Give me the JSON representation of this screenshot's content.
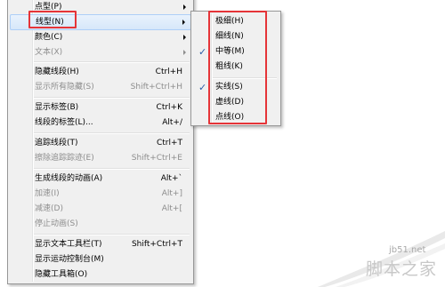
{
  "menu": {
    "items": [
      {
        "label": "点型(P)",
        "shortcut": "",
        "submenu": true,
        "disabled": false
      },
      {
        "label": "线型(N)",
        "shortcut": "",
        "submenu": true,
        "disabled": false
      },
      {
        "label": "颜色(C)",
        "shortcut": "",
        "submenu": true,
        "disabled": false
      },
      {
        "label": "文本(X)",
        "shortcut": "",
        "submenu": true,
        "disabled": true
      },
      {
        "label": "隐藏线段(H)",
        "shortcut": "Ctrl+H",
        "submenu": false,
        "disabled": false
      },
      {
        "label": "显示所有隐藏(S)",
        "shortcut": "Shift+Ctrl+H",
        "submenu": false,
        "disabled": true
      },
      {
        "label": "显示标签(B)",
        "shortcut": "Ctrl+K",
        "submenu": false,
        "disabled": false
      },
      {
        "label": "线段的标签(L)...",
        "shortcut": "Alt+/",
        "submenu": false,
        "disabled": false
      },
      {
        "label": "追踪线段(T)",
        "shortcut": "Ctrl+T",
        "submenu": false,
        "disabled": false
      },
      {
        "label": "擦除追踪踪迹(E)",
        "shortcut": "Shift+Ctrl+E",
        "submenu": false,
        "disabled": true
      },
      {
        "label": "生成线段的动画(A)",
        "shortcut": "Alt+`",
        "submenu": false,
        "disabled": false
      },
      {
        "label": "加速(I)",
        "shortcut": "Alt+]",
        "submenu": false,
        "disabled": true
      },
      {
        "label": "减速(D)",
        "shortcut": "Alt+[",
        "submenu": false,
        "disabled": true
      },
      {
        "label": "停止动画(S)",
        "shortcut": "",
        "submenu": false,
        "disabled": true
      },
      {
        "label": "显示文本工具栏(T)",
        "shortcut": "Shift+Ctrl+T",
        "submenu": false,
        "disabled": false
      },
      {
        "label": "显示运动控制台(M)",
        "shortcut": "",
        "submenu": false,
        "disabled": false
      },
      {
        "label": "隐藏工具箱(O)",
        "shortcut": "",
        "submenu": false,
        "disabled": false
      }
    ]
  },
  "submenu": {
    "items": [
      {
        "label": "极细(H)",
        "checked": false
      },
      {
        "label": "细线(N)",
        "checked": false
      },
      {
        "label": "中等(M)",
        "checked": true
      },
      {
        "label": "粗线(K)",
        "checked": false
      },
      {
        "label": "实线(S)",
        "checked": true
      },
      {
        "label": "虚线(D)",
        "checked": false
      },
      {
        "label": "点线(O)",
        "checked": false
      }
    ]
  },
  "watermark": {
    "url": "jb51.net",
    "title": "脚本之家"
  },
  "colors": {
    "highlight_box": "#e53438",
    "menu_bg": "#f0f0f0",
    "check": "#2a5ea8"
  }
}
